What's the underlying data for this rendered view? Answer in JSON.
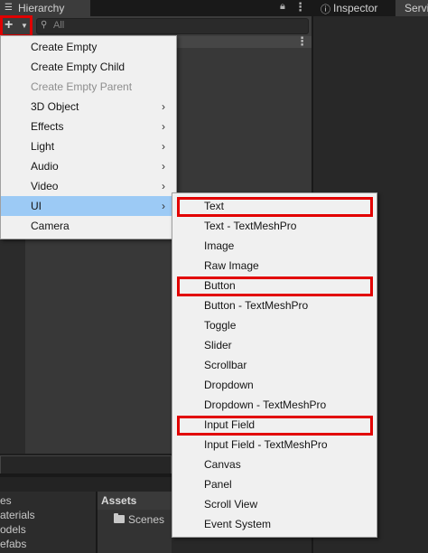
{
  "tabs": {
    "hierarchy": "Hierarchy",
    "inspector": "Inspector",
    "services": "Servi"
  },
  "icons": {
    "hierarchy_tab": "list-icon",
    "lock": "lock-icon",
    "more": "kebab-menu-icon",
    "inspector_tab": "info-icon",
    "add": "plus-icon",
    "add_dropdown": "caret-down-icon",
    "search": "search-icon",
    "folder": "folder-icon",
    "submenu_arrow": "chevron-right-icon"
  },
  "search": {
    "placeholder": "All"
  },
  "main_menu": {
    "items": [
      {
        "label": "Create Empty",
        "has_submenu": false,
        "state": "normal"
      },
      {
        "label": "Create Empty Child",
        "has_submenu": false,
        "state": "normal"
      },
      {
        "label": "Create Empty Parent",
        "has_submenu": false,
        "state": "disabled"
      },
      {
        "label": "3D Object",
        "has_submenu": true,
        "state": "normal"
      },
      {
        "label": "Effects",
        "has_submenu": true,
        "state": "normal"
      },
      {
        "label": "Light",
        "has_submenu": true,
        "state": "normal"
      },
      {
        "label": "Audio",
        "has_submenu": true,
        "state": "normal"
      },
      {
        "label": "Video",
        "has_submenu": true,
        "state": "normal"
      },
      {
        "label": "UI",
        "has_submenu": true,
        "state": "active"
      },
      {
        "label": "Camera",
        "has_submenu": false,
        "state": "normal"
      }
    ],
    "arrow_glyph": "›"
  },
  "sub_menu": {
    "items": [
      {
        "label": "Text",
        "highlighted": true
      },
      {
        "label": "Text - TextMeshPro",
        "highlighted": false
      },
      {
        "label": "Image",
        "highlighted": false
      },
      {
        "label": "Raw Image",
        "highlighted": false
      },
      {
        "label": "Button",
        "highlighted": true
      },
      {
        "label": "Button - TextMeshPro",
        "highlighted": false
      },
      {
        "label": "Toggle",
        "highlighted": false
      },
      {
        "label": "Slider",
        "highlighted": false
      },
      {
        "label": "Scrollbar",
        "highlighted": false
      },
      {
        "label": "Dropdown",
        "highlighted": false
      },
      {
        "label": "Dropdown - TextMeshPro",
        "highlighted": false
      },
      {
        "label": "Input Field",
        "highlighted": true
      },
      {
        "label": "Input Field - TextMeshPro",
        "highlighted": false
      },
      {
        "label": "Canvas",
        "highlighted": false
      },
      {
        "label": "Panel",
        "highlighted": false
      },
      {
        "label": "Scroll View",
        "highlighted": false
      },
      {
        "label": "Event System",
        "highlighted": false
      }
    ]
  },
  "project": {
    "tree": [
      "es",
      "aterials",
      "odels",
      "efabs"
    ],
    "assets_header": "Assets",
    "assets_items": [
      "Scenes"
    ]
  },
  "colors": {
    "highlight_border": "#e20000",
    "active_item_bg": "#9ccaf5",
    "menu_bg": "#f0f0f0"
  }
}
